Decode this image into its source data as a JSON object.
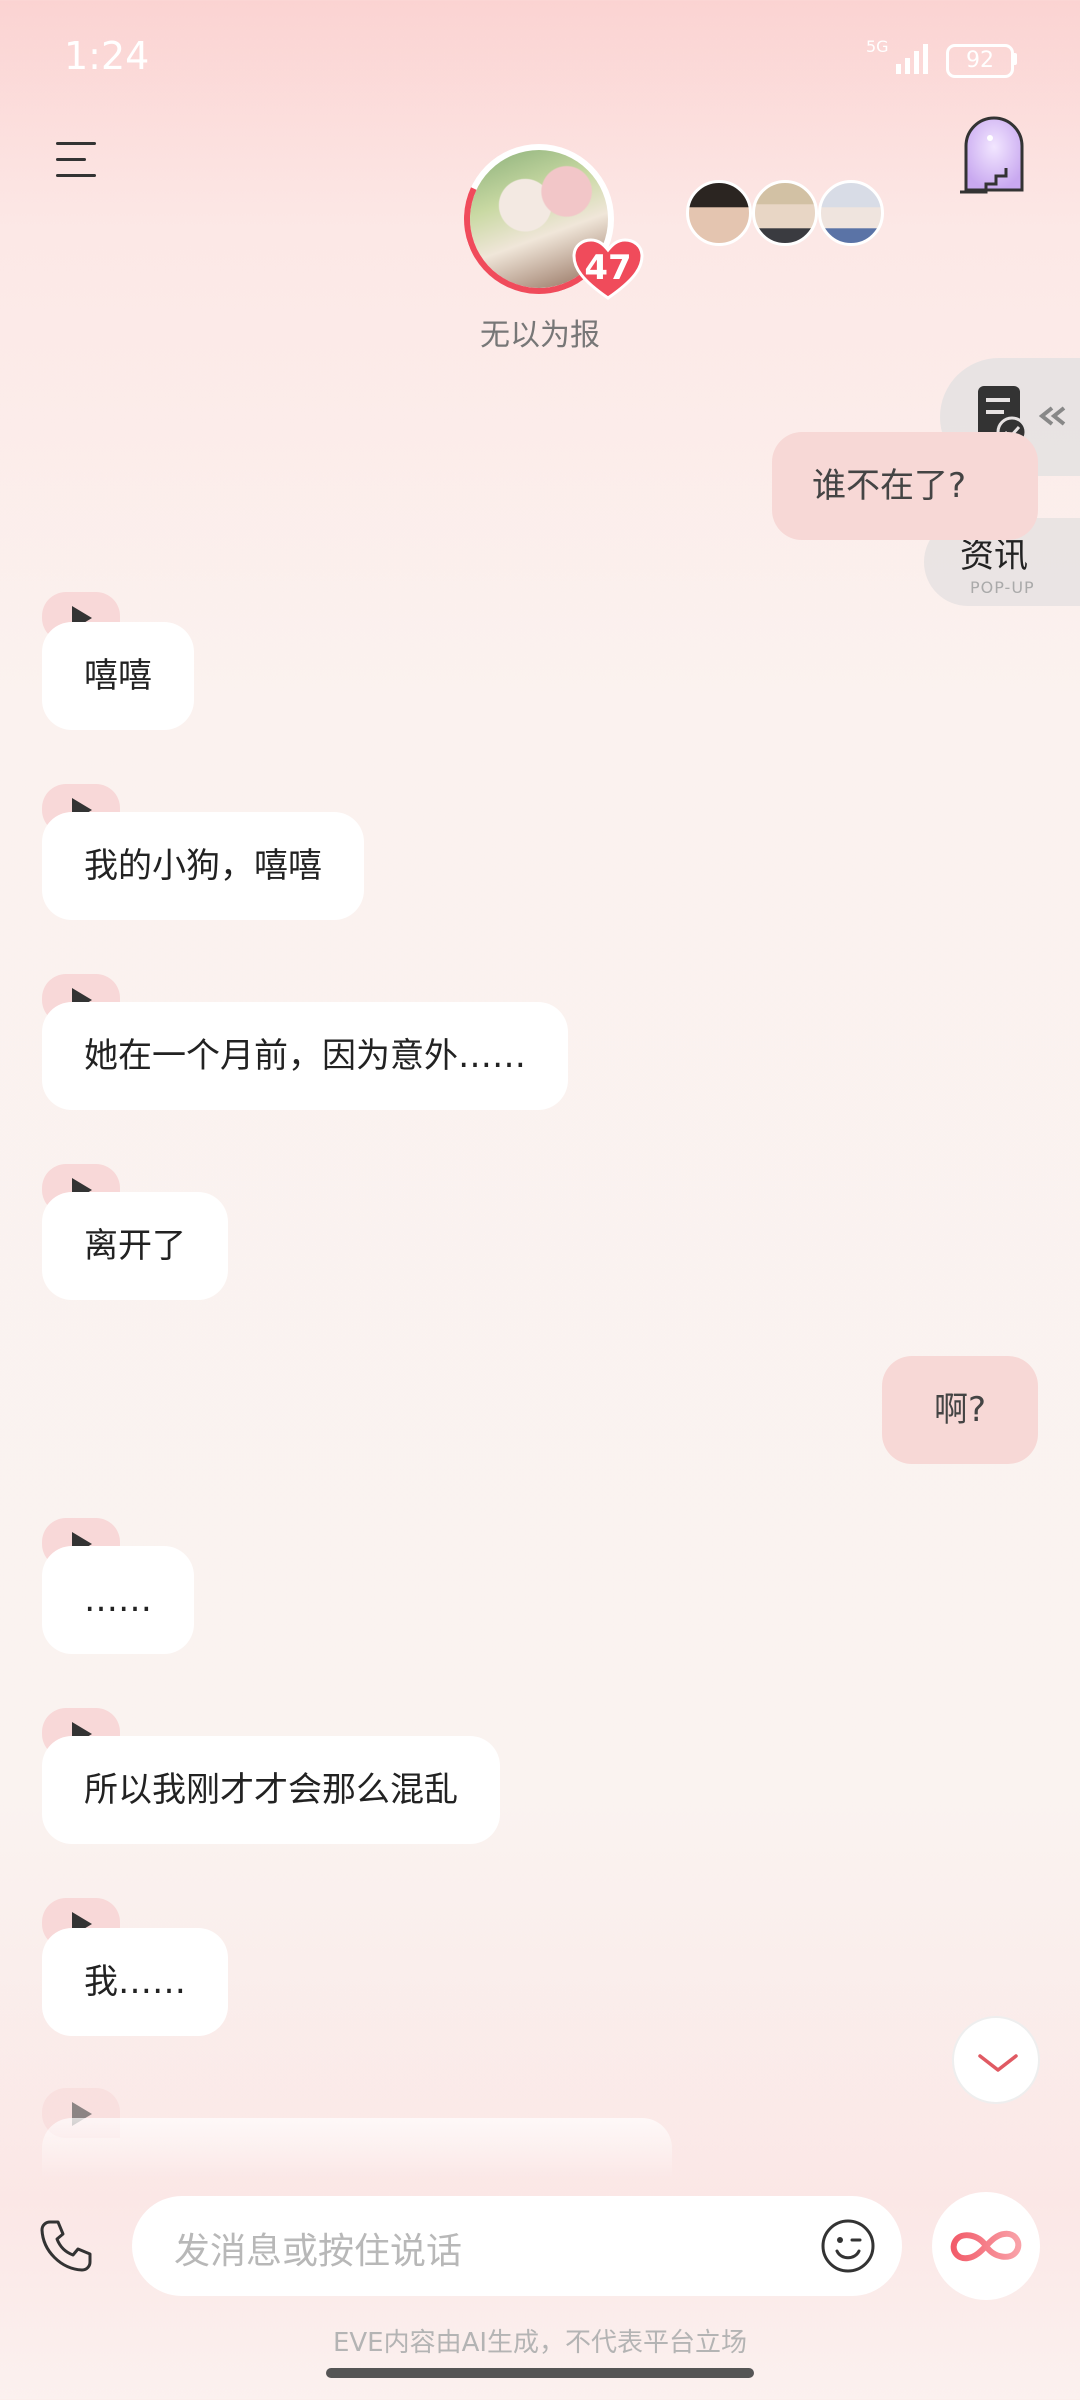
{
  "status_bar": {
    "time": "1:24",
    "network": "5G",
    "battery": "92"
  },
  "header": {
    "character_name": "无以为报",
    "affinity": "47"
  },
  "side_popup": {
    "title": "资讯",
    "subtitle": "POP-UP"
  },
  "messages": [
    {
      "role": "user",
      "text": "谁不在了?"
    },
    {
      "role": "ai",
      "text": "嘻嘻"
    },
    {
      "role": "ai",
      "text": "我的小狗，嘻嘻"
    },
    {
      "role": "ai",
      "text": "她在一个月前，因为意外……"
    },
    {
      "role": "ai",
      "text": "离开了"
    },
    {
      "role": "user",
      "text": "啊?"
    },
    {
      "role": "ai",
      "text": "……"
    },
    {
      "role": "ai",
      "text": "所以我刚才才会那么混乱"
    },
    {
      "role": "ai",
      "text": "我……"
    }
  ],
  "input": {
    "placeholder": "发消息或按住说话"
  },
  "footer": {
    "disclaimer": "EVE内容由AI生成，不代表平台立场"
  },
  "colors": {
    "accent": "#f04b5b",
    "user_bubble": "#f7d8d6",
    "ai_bubble": "#ffffff"
  },
  "icons": [
    "menu-icon",
    "door-icon",
    "task-icon",
    "chevron-left-icon",
    "play-icon",
    "chevron-down-icon",
    "phone-icon",
    "emoji-icon",
    "infinity-icon"
  ]
}
